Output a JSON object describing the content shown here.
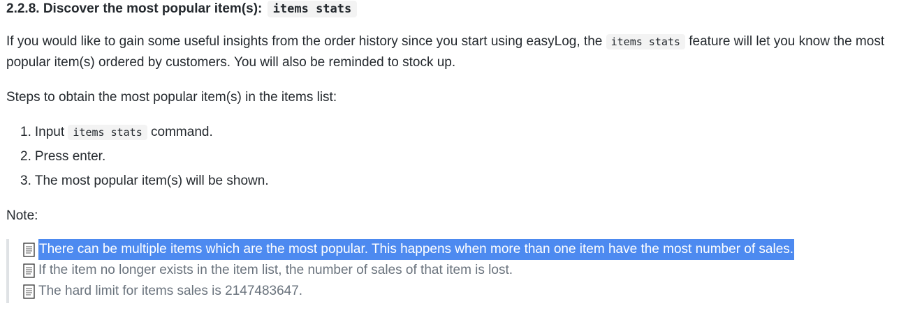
{
  "section": {
    "heading_text": "2.2.8. Discover the most popular item(s):",
    "heading_code": "items stats"
  },
  "intro": {
    "part1": "If you would like to gain some useful insights from the order history since you start using easyLog, the",
    "code": "items stats",
    "part2": "feature will let you know the most popular item(s) ordered by customers. You will also be reminded to stock up."
  },
  "steps_intro": "Steps to obtain the most popular item(s) in the items list:",
  "steps": [
    {
      "num": "1.",
      "before": "Input",
      "code": "items stats",
      "after": "command."
    },
    {
      "num": "2.",
      "text": "Press enter."
    },
    {
      "num": "3.",
      "text": "The most popular item(s) will be shown."
    }
  ],
  "note_label": "Note:",
  "notes": [
    {
      "icon": "memo-icon",
      "text": "There can be multiple items which are the most popular. This happens when more than one item have the most number of sales.",
      "selected": true
    },
    {
      "icon": "memo-icon",
      "text": "If the item no longer exists in the item list, the number of sales of that item is lost.",
      "selected": false
    },
    {
      "icon": "memo-icon",
      "text": "The hard limit for items sales is 2147483647.",
      "selected": false
    }
  ],
  "colors": {
    "selection": "#4d8af0",
    "code_background": "#f3f3f3",
    "quote_border": "#dfe2e5",
    "quote_text": "#6a737d"
  }
}
